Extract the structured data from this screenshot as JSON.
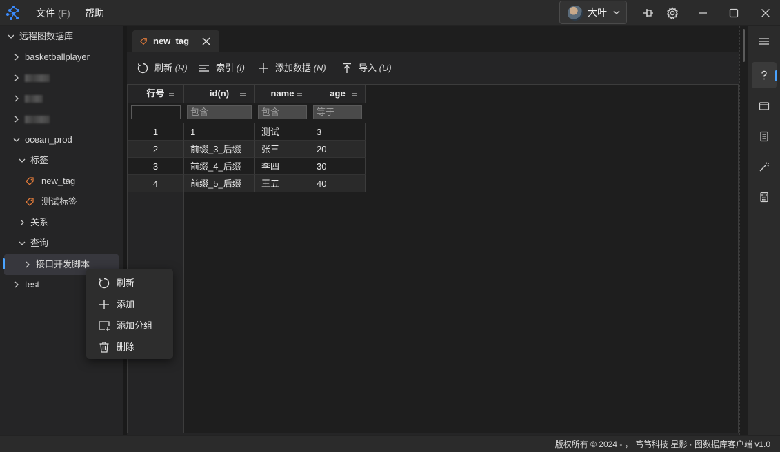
{
  "menubar": {
    "file": "文件",
    "file_hotkey": "(F)",
    "help": "帮助"
  },
  "user": {
    "name": "大叶"
  },
  "sidebar": {
    "root_label": "远程图数据库",
    "items": {
      "basketballplayer": "basketballplayer",
      "ocean_prod": "ocean_prod",
      "tags_group": "标签",
      "tag_new": "new_tag",
      "tag_test": "测试标签",
      "relations": "关系",
      "queries": "查询",
      "query_script": "接口开发脚本",
      "test": "test"
    }
  },
  "tab": {
    "name": "new_tag"
  },
  "toolbar": {
    "refresh": "刷新",
    "refresh_key": "(R)",
    "index": "索引",
    "index_key": "(I)",
    "add_data": "添加数据",
    "add_data_key": "(N)",
    "import": "导入",
    "import_key": "(U)"
  },
  "table": {
    "headers": [
      "行号",
      "id(n)",
      "name",
      "age"
    ],
    "filters": [
      "",
      "包含",
      "包含",
      "等于"
    ],
    "rows": [
      [
        "1",
        "1",
        "测试",
        "3"
      ],
      [
        "2",
        "前缀_3_后缀",
        "张三",
        "20"
      ],
      [
        "3",
        "前缀_4_后缀",
        "李四",
        "30"
      ],
      [
        "4",
        "前缀_5_后缀",
        "王五",
        "40"
      ]
    ]
  },
  "context_menu": {
    "refresh": "刷新",
    "add": "添加",
    "add_group": "添加分组",
    "delete": "删除"
  },
  "statusbar": {
    "text": "版权所有 © 2024 - ， 笃笃科技 星影 · 图数据库客户端 v1.0"
  },
  "colors": {
    "accent": "#4aa3ff",
    "tag_icon": "#e07a3a",
    "background": "#1e1e1e"
  }
}
